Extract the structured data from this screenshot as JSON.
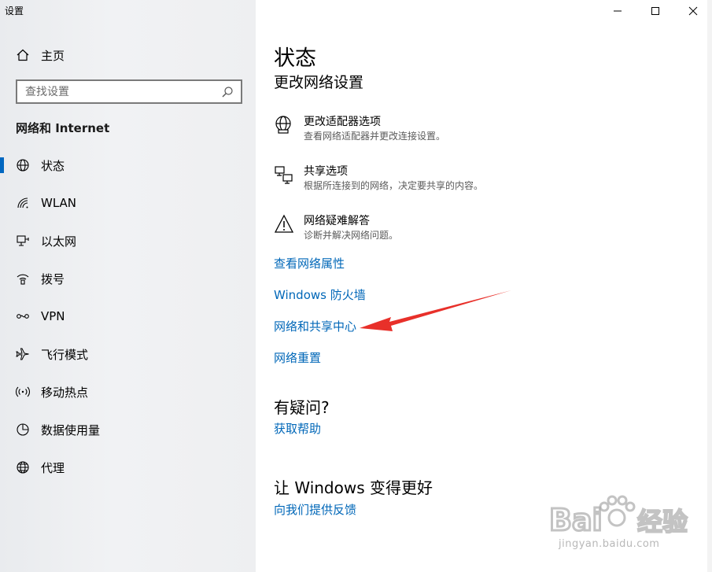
{
  "window": {
    "title": "设置"
  },
  "sidebar": {
    "home_label": "主页",
    "search_placeholder": "查找设置",
    "section_title": "网络和 Internet",
    "items": [
      {
        "label": "状态",
        "icon": "globe-icon",
        "active": true
      },
      {
        "label": "WLAN",
        "icon": "wifi-icon"
      },
      {
        "label": "以太网",
        "icon": "ethernet-icon"
      },
      {
        "label": "拨号",
        "icon": "dialup-icon"
      },
      {
        "label": "VPN",
        "icon": "vpn-icon"
      },
      {
        "label": "飞行模式",
        "icon": "airplane-icon"
      },
      {
        "label": "移动热点",
        "icon": "hotspot-icon"
      },
      {
        "label": "数据使用量",
        "icon": "data-usage-icon"
      },
      {
        "label": "代理",
        "icon": "proxy-globe-icon"
      }
    ]
  },
  "main": {
    "title": "状态",
    "subtitle": "更改网络设置",
    "options": [
      {
        "title": "更改适配器选项",
        "desc": "查看网络适配器并更改连接设置。",
        "icon": "adapter-globe-icon"
      },
      {
        "title": "共享选项",
        "desc": "根据所连接到的网络，决定要共享的内容。",
        "icon": "sharing-icon"
      },
      {
        "title": "网络疑难解答",
        "desc": "诊断并解决网络问题。",
        "icon": "warning-icon"
      }
    ],
    "links": [
      "查看网络属性",
      "Windows 防火墙",
      "网络和共享中心",
      "网络重置"
    ],
    "help_heading": "有疑问?",
    "help_link": "获取帮助",
    "feedback_heading": "让 Windows 变得更好",
    "feedback_link": "向我们提供反馈"
  },
  "annotation": {
    "arrow_color": "#e8302a"
  },
  "watermark": {
    "url": "jingyan.baidu.com"
  },
  "colors": {
    "accent": "#0067c0",
    "link": "#0067b8"
  }
}
